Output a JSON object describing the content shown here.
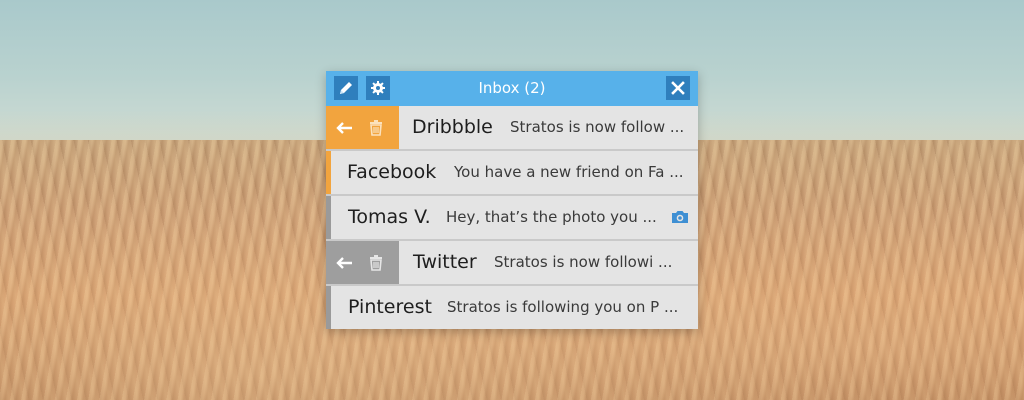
{
  "window": {
    "title": "Inbox (2)",
    "accent_color": "#57b1ea",
    "unread_color": "#f2a43e"
  },
  "toolbar": {
    "compose_icon": "pencil-icon",
    "settings_icon": "gear-icon",
    "close_icon": "close-icon"
  },
  "messages": [
    {
      "sender": "Dribbble",
      "snippet": "Stratos is now follow ...",
      "state": "swiped-unread",
      "actions": [
        "back-arrow-icon",
        "trash-icon"
      ]
    },
    {
      "sender": "Facebook",
      "snippet": "You have a new friend on Fa ...",
      "state": "unread"
    },
    {
      "sender": "Tomas V.",
      "snippet": "Hey, that’s the photo you ...",
      "state": "read",
      "attachment_icon": "camera-icon"
    },
    {
      "sender": "Twitter",
      "snippet": "Stratos is now followi ...",
      "state": "swiped-read",
      "actions": [
        "back-arrow-icon",
        "trash-icon"
      ]
    },
    {
      "sender": "Pinterest",
      "snippet": "Stratos is following you on P ...",
      "state": "read"
    }
  ]
}
